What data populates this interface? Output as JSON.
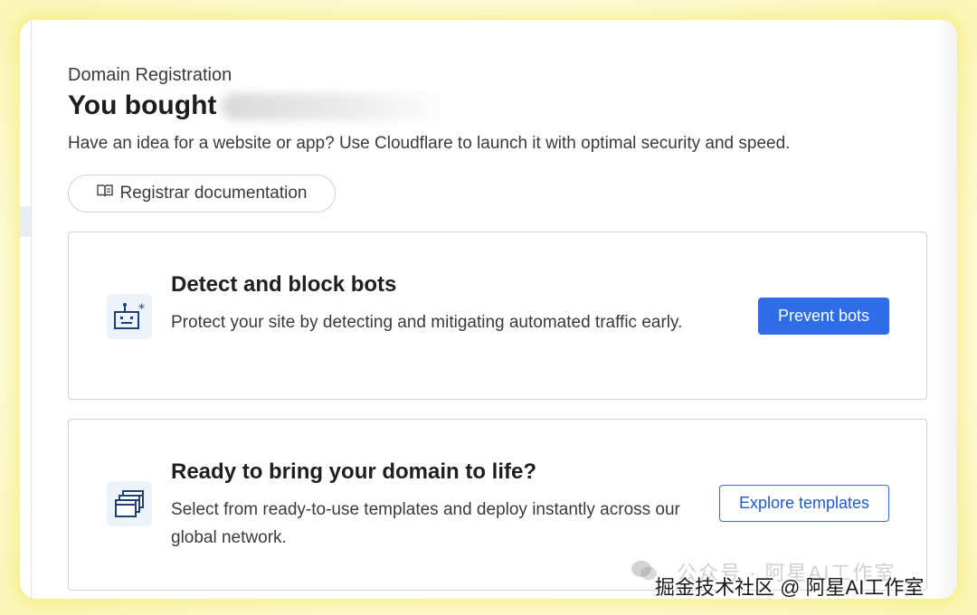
{
  "header": {
    "eyebrow": "Domain Registration",
    "title": "You bought",
    "subtitle": "Have an idea for a website or app? Use Cloudflare to launch it with optimal security and speed.",
    "doc_button_label": "Registrar documentation"
  },
  "cards": [
    {
      "icon": "bot-icon",
      "title": "Detect and block bots",
      "description": "Protect your site by detecting and mitigating automated traffic early.",
      "button_label": "Prevent bots"
    },
    {
      "icon": "templates-icon",
      "title": "Ready to bring your domain to life?",
      "description": "Select from ready-to-use templates and deploy instantly across our global network.",
      "button_label": "Explore templates"
    }
  ],
  "watermark": {
    "faint_text": "公众号 · 阿星AI工作室",
    "main_text": "掘金技术社区 @ 阿星AI工作室"
  },
  "colors": {
    "primary": "#2f6ce8",
    "icon_bg": "#edf3fb",
    "glow": "#f0e65a"
  }
}
